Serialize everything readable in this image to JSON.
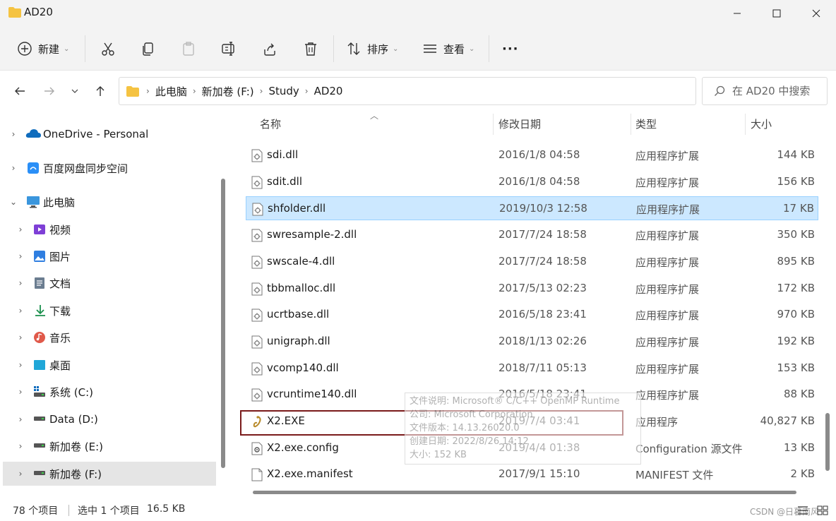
{
  "window": {
    "title": "AD20",
    "min_icon": "minimize-icon",
    "max_icon": "maximize-icon",
    "close_icon": "close-icon"
  },
  "toolbar": {
    "new_label": "新建",
    "sort_label": "排序",
    "view_label": "查看",
    "more_label": "···"
  },
  "address": {
    "crumbs": [
      "此电脑",
      "新加卷 (F:)",
      "Study",
      "AD20"
    ]
  },
  "search": {
    "placeholder": "在 AD20 中搜索"
  },
  "sidebar": {
    "items": [
      {
        "label": "OneDrive - Personal",
        "icon": "onedrive-icon"
      },
      {
        "label": "百度网盘同步空间",
        "icon": "baidu-netdisk-icon"
      },
      {
        "label": "此电脑",
        "icon": "pc-icon"
      },
      {
        "label": "视频",
        "icon": "videos-icon"
      },
      {
        "label": "图片",
        "icon": "pictures-icon"
      },
      {
        "label": "文档",
        "icon": "documents-icon"
      },
      {
        "label": "下载",
        "icon": "downloads-icon"
      },
      {
        "label": "音乐",
        "icon": "music-icon"
      },
      {
        "label": "桌面",
        "icon": "desktop-icon"
      },
      {
        "label": "系统 (C:)",
        "icon": "drive-icon"
      },
      {
        "label": "Data (D:)",
        "icon": "drive-icon"
      },
      {
        "label": "新加卷 (E:)",
        "icon": "drive-icon"
      },
      {
        "label": "新加卷 (F:)",
        "icon": "drive-icon"
      }
    ]
  },
  "columns": {
    "name": "名称",
    "date": "修改日期",
    "type": "类型",
    "size": "大小"
  },
  "files": [
    {
      "name": "sdi.dll",
      "date": "2016/1/8 04:58",
      "type": "应用程序扩展",
      "size": "144 KB"
    },
    {
      "name": "sdit.dll",
      "date": "2016/1/8 04:58",
      "type": "应用程序扩展",
      "size": "156 KB"
    },
    {
      "name": "shfolder.dll",
      "date": "2019/10/3 12:58",
      "type": "应用程序扩展",
      "size": "17 KB"
    },
    {
      "name": "swresample-2.dll",
      "date": "2017/7/24 18:58",
      "type": "应用程序扩展",
      "size": "350 KB"
    },
    {
      "name": "swscale-4.dll",
      "date": "2017/7/24 18:58",
      "type": "应用程序扩展",
      "size": "895 KB"
    },
    {
      "name": "tbbmalloc.dll",
      "date": "2017/5/13 02:23",
      "type": "应用程序扩展",
      "size": "172 KB"
    },
    {
      "name": "ucrtbase.dll",
      "date": "2016/5/18 23:41",
      "type": "应用程序扩展",
      "size": "970 KB"
    },
    {
      "name": "unigraph.dll",
      "date": "2018/1/13 02:26",
      "type": "应用程序扩展",
      "size": "192 KB"
    },
    {
      "name": "vcomp140.dll",
      "date": "2018/7/11 05:13",
      "type": "应用程序扩展",
      "size": "153 KB"
    },
    {
      "name": "vcruntime140.dll",
      "date": "2016/5/18 23:41",
      "type": "应用程序扩展",
      "size": "88 KB"
    },
    {
      "name": "X2.EXE",
      "date": "2019/7/4 03:41",
      "type": "应用程序",
      "size": "40,827 KB"
    },
    {
      "name": "X2.exe.config",
      "date": "2019/4/4 01:38",
      "type": "Configuration 源文件",
      "size": "13 KB"
    },
    {
      "name": "X2.exe.manifest",
      "date": "2017/9/1 15:10",
      "type": "MANIFEST 文件",
      "size": "2 KB"
    }
  ],
  "tooltip": {
    "line1": "文件说明: Microsoft® C/C++ OpenMP Runtime",
    "line2": "公司: Microsoft Corporation",
    "line3": "文件版本: 14.13.26020.0",
    "line4": "创建日期: 2022/8/26 14:12",
    "line5": "大小: 152 KB"
  },
  "status": {
    "count": "78 个项目",
    "selected": "选中 1 个项目",
    "size": "16.5 KB",
    "watermark": "CSDN @日暮南风"
  },
  "colors": {
    "selection": "#cce8ff",
    "highlight_border": "#7a1a1a",
    "folder": "#f5c342"
  }
}
